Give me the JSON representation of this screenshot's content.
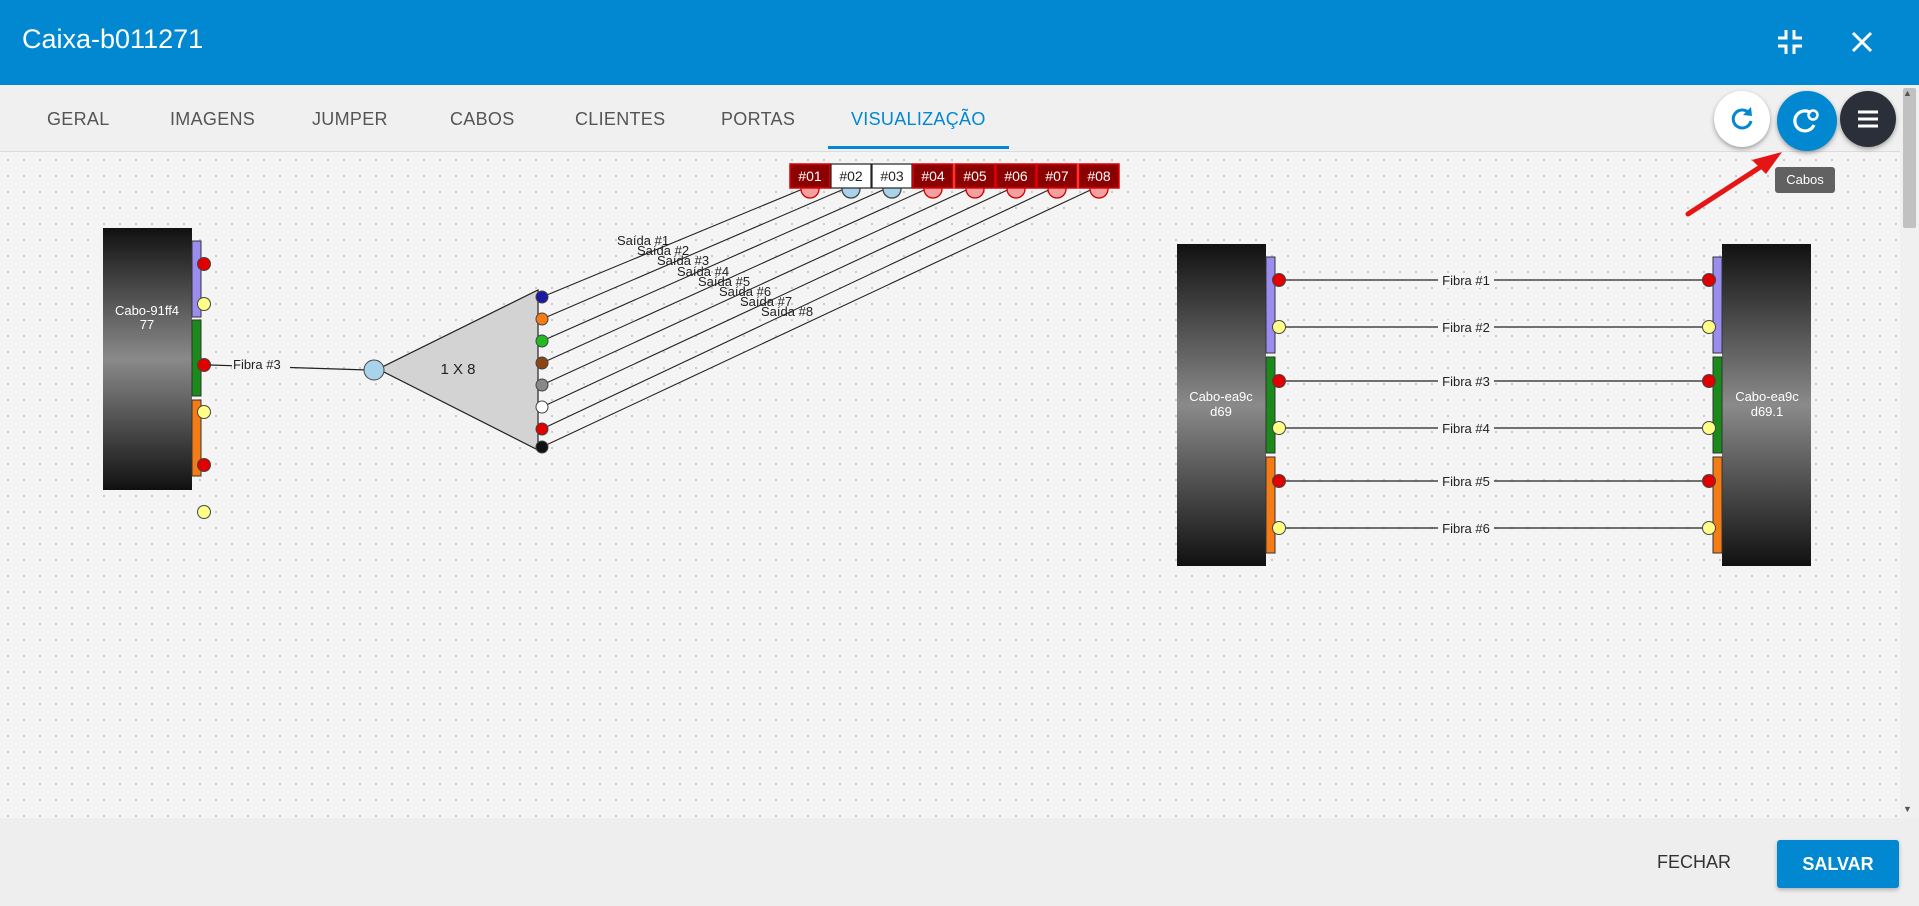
{
  "header": {
    "title": "Caixa-b011271"
  },
  "tabs": [
    {
      "label": "GERAL"
    },
    {
      "label": "IMAGENS"
    },
    {
      "label": "JUMPER"
    },
    {
      "label": "CABOS"
    },
    {
      "label": "CLIENTES"
    },
    {
      "label": "PORTAS"
    },
    {
      "label": "VISUALIZAÇÃO"
    }
  ],
  "tooltip": "Cabos",
  "footer": {
    "close_label": "FECHAR",
    "save_label": "SALVAR"
  },
  "diagram": {
    "left_cable": {
      "name_line1": "Cabo-91ff4",
      "name_line2": "77"
    },
    "left_fiber_label": "Fibra #3",
    "splitter": {
      "label": "1 X 8"
    },
    "outputs": [
      "Saída #1",
      "Saída #2",
      "Saída #3",
      "Saída #4",
      "Saída #5",
      "Saída #6",
      "Saída #7",
      "Saída #8"
    ],
    "ports": [
      {
        "label": "#01",
        "active": true
      },
      {
        "label": "#02",
        "active": false
      },
      {
        "label": "#03",
        "active": false
      },
      {
        "label": "#04",
        "active": true
      },
      {
        "label": "#05",
        "active": true
      },
      {
        "label": "#06",
        "active": true
      },
      {
        "label": "#07",
        "active": true
      },
      {
        "label": "#08",
        "active": true
      }
    ],
    "cable_a": {
      "name_line1": "Cabo-ea9c",
      "name_line2": "d69"
    },
    "cable_b": {
      "name_line1": "Cabo-ea9c",
      "name_line2": "d69.1"
    },
    "fibers": [
      "Fibra #1",
      "Fibra #2",
      "Fibra #3",
      "Fibra #4",
      "Fibra #5",
      "Fibra #6"
    ]
  },
  "colors": {
    "primary": "#0288d1",
    "tube_blue": "#9b8df0",
    "tube_green": "#1a8a1a",
    "tube_orange": "#f57c14",
    "port_active": "#8b0000"
  }
}
